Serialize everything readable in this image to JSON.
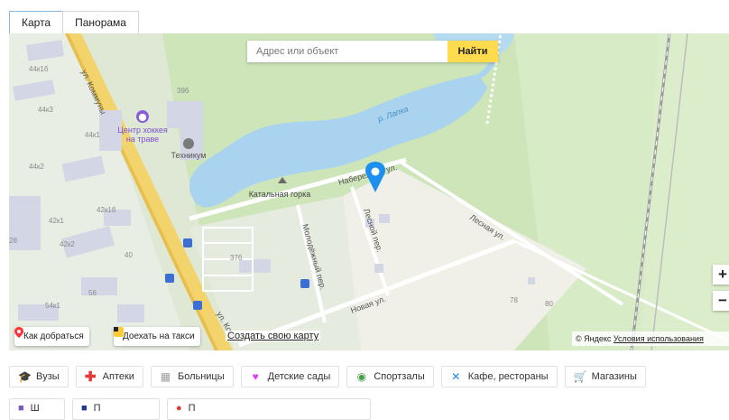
{
  "tabs": [
    {
      "label": "Карта",
      "active": true
    },
    {
      "label": "Панорама",
      "active": false
    }
  ],
  "search": {
    "placeholder": "Адрес или объект",
    "button_label": "Найти"
  },
  "map": {
    "labels": {
      "street_kommuny": "ул. Коммуны",
      "street_kommuny_bottom": "ул. Ком",
      "river": "р. Лапка",
      "hockey_center": "Центр хоккея",
      "hockey_center_2": "на траве",
      "technikum": "Техникум",
      "katalnaya_gorka": "Катальная горка",
      "naberezhnaya": "Набережная ул.",
      "lesnoy_per": "Лесной пер.",
      "lesnaya_ul": "Лесная ул.",
      "molodezhny_per": "Молодёжный пер.",
      "novaya_ul": "Новая ул."
    },
    "house_numbers": [
      "44к1б",
      "44к3",
      "44к1",
      "44к2",
      "42к1б",
      "42к1",
      "42к2",
      "28",
      "40",
      "37б",
      "39б",
      "56",
      "54к1",
      "78",
      "80"
    ]
  },
  "map_buttons": {
    "route": "Как добраться",
    "taxi": "Доехать на такси",
    "create_map": "Создать свою карту"
  },
  "copyright": {
    "brand": "© Яндекс",
    "terms": "Условия использования"
  },
  "zoom": {
    "in": "+",
    "out": "−"
  },
  "categories": [
    {
      "label": "Вузы",
      "icon": "graduation-cap-icon",
      "color": "#2f8fd8"
    },
    {
      "label": "Аптеки",
      "icon": "pharmacy-cross-icon",
      "color": "#e53935"
    },
    {
      "label": "Больницы",
      "icon": "hospital-icon",
      "color": "#9e9e9e"
    },
    {
      "label": "Детские сады",
      "icon": "stroller-icon",
      "color": "#e040fb"
    },
    {
      "label": "Спортзалы",
      "icon": "sport-icon",
      "color": "#43a047"
    },
    {
      "label": "Кафе, рестораны",
      "icon": "cutlery-icon",
      "color": "#1e88e5"
    },
    {
      "label": "Магазины",
      "icon": "cart-icon",
      "color": "#fb8c00"
    }
  ],
  "categories_row2": [
    {
      "label": "Ш",
      "icon": "school-icon",
      "color": "#7e57c2"
    },
    {
      "label": "П",
      "icon": "post-icon",
      "color": "#1e3a8a"
    },
    {
      "label": "П",
      "icon": "place-icon",
      "color": "#e53935"
    }
  ]
}
